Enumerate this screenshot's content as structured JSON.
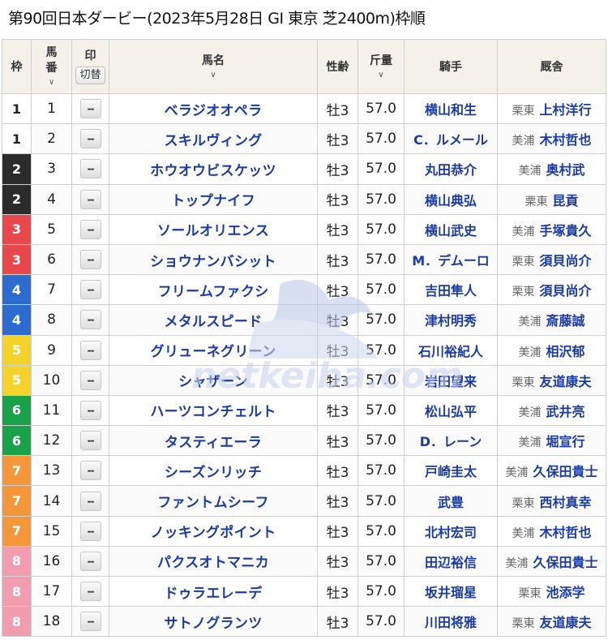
{
  "page": {
    "title": "第90回日本ダービー(2023年5月28日 GI 東京 芝2400m)枠順"
  },
  "table": {
    "headers": {
      "waku": "枠",
      "umaban": "馬番",
      "mark": "印",
      "mark_toggle": "切替",
      "horse": "馬名",
      "sexage": "性齢",
      "weight": "斤量",
      "jockey": "騎手",
      "stable": "厩舎"
    },
    "sort_icon": "chevron-down-icon",
    "mark_placeholder": "--",
    "rows": [
      {
        "waku": "1",
        "umaban": "1",
        "horse": "ベラジオオペラ",
        "sexage": "牡3",
        "weight": "57.0",
        "jockey": "横山和生",
        "area": "栗東",
        "trainer": "上村洋行"
      },
      {
        "waku": "1",
        "umaban": "2",
        "horse": "スキルヴィング",
        "sexage": "牡3",
        "weight": "57.0",
        "jockey": "C．ルメール",
        "area": "美浦",
        "trainer": "木村哲也"
      },
      {
        "waku": "2",
        "umaban": "3",
        "horse": "ホウオウビスケッツ",
        "sexage": "牡3",
        "weight": "57.0",
        "jockey": "丸田恭介",
        "area": "美浦",
        "trainer": "奥村武"
      },
      {
        "waku": "2",
        "umaban": "4",
        "horse": "トップナイフ",
        "sexage": "牡3",
        "weight": "57.0",
        "jockey": "横山典弘",
        "area": "栗東",
        "trainer": "昆貢"
      },
      {
        "waku": "3",
        "umaban": "5",
        "horse": "ソールオリエンス",
        "sexage": "牡3",
        "weight": "57.0",
        "jockey": "横山武史",
        "area": "美浦",
        "trainer": "手塚貴久"
      },
      {
        "waku": "3",
        "umaban": "6",
        "horse": "ショウナンバシット",
        "sexage": "牡3",
        "weight": "57.0",
        "jockey": "M．デムーロ",
        "area": "栗東",
        "trainer": "須貝尚介"
      },
      {
        "waku": "4",
        "umaban": "7",
        "horse": "フリームファクシ",
        "sexage": "牡3",
        "weight": "57.0",
        "jockey": "吉田隼人",
        "area": "栗東",
        "trainer": "須貝尚介"
      },
      {
        "waku": "4",
        "umaban": "8",
        "horse": "メタルスピード",
        "sexage": "牡3",
        "weight": "57.0",
        "jockey": "津村明秀",
        "area": "美浦",
        "trainer": "斎藤誠"
      },
      {
        "waku": "5",
        "umaban": "9",
        "horse": "グリューネグリーン",
        "sexage": "牡3",
        "weight": "57.0",
        "jockey": "石川裕紀人",
        "area": "美浦",
        "trainer": "相沢郁"
      },
      {
        "waku": "5",
        "umaban": "10",
        "horse": "シャザーン",
        "sexage": "牡3",
        "weight": "57.0",
        "jockey": "岩田望来",
        "area": "栗東",
        "trainer": "友道康夫"
      },
      {
        "waku": "6",
        "umaban": "11",
        "horse": "ハーツコンチェルト",
        "sexage": "牡3",
        "weight": "57.0",
        "jockey": "松山弘平",
        "area": "美浦",
        "trainer": "武井亮"
      },
      {
        "waku": "6",
        "umaban": "12",
        "horse": "タスティエーラ",
        "sexage": "牡3",
        "weight": "57.0",
        "jockey": "D．レーン",
        "area": "美浦",
        "trainer": "堀宣行"
      },
      {
        "waku": "7",
        "umaban": "13",
        "horse": "シーズンリッチ",
        "sexage": "牡3",
        "weight": "57.0",
        "jockey": "戸崎圭太",
        "area": "美浦",
        "trainer": "久保田貴士"
      },
      {
        "waku": "7",
        "umaban": "14",
        "horse": "ファントムシーフ",
        "sexage": "牡3",
        "weight": "57.0",
        "jockey": "武豊",
        "area": "栗東",
        "trainer": "西村真幸"
      },
      {
        "waku": "7",
        "umaban": "15",
        "horse": "ノッキングポイント",
        "sexage": "牡3",
        "weight": "57.0",
        "jockey": "北村宏司",
        "area": "美浦",
        "trainer": "木村哲也"
      },
      {
        "waku": "8",
        "umaban": "16",
        "horse": "パクスオトマニカ",
        "sexage": "牡3",
        "weight": "57.0",
        "jockey": "田辺裕信",
        "area": "美浦",
        "trainer": "久保田貴士"
      },
      {
        "waku": "8",
        "umaban": "17",
        "horse": "ドゥラエレーデ",
        "sexage": "牡3",
        "weight": "57.0",
        "jockey": "坂井瑠星",
        "area": "栗東",
        "trainer": "池添学"
      },
      {
        "waku": "8",
        "umaban": "18",
        "horse": "サトノグランツ",
        "sexage": "牡3",
        "weight": "57.0",
        "jockey": "川田将雅",
        "area": "栗東",
        "trainer": "友道康夫"
      }
    ]
  },
  "waku_colors": {
    "1": {
      "bg": "#ffffff",
      "fg": "#222222"
    },
    "2": {
      "bg": "#2b2b2b",
      "fg": "#ffffff"
    },
    "3": {
      "bg": "#e8474c",
      "fg": "#ffffff"
    },
    "4": {
      "bg": "#2e6bd0",
      "fg": "#ffffff"
    },
    "5": {
      "bg": "#f2d22b",
      "fg": "#ffffff"
    },
    "6": {
      "bg": "#1aa24a",
      "fg": "#ffffff"
    },
    "7": {
      "bg": "#f4973a",
      "fg": "#ffffff"
    },
    "8": {
      "bg": "#f29cb0",
      "fg": "#ffffff"
    }
  },
  "colors": {
    "link": "#1a3aa6",
    "header_bg": "#f3f1ea"
  }
}
